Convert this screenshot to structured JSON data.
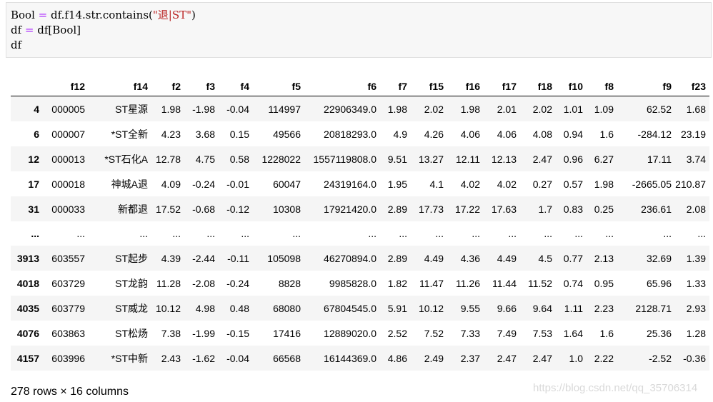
{
  "code_lines": [
    {
      "pre": "Bool ",
      "op": "=",
      "mid": " df.f14.str.contains(",
      "str": "\"退|ST\"",
      "post": ")"
    },
    {
      "pre": "df ",
      "op": "=",
      "mid": " df[Bool]",
      "str": "",
      "post": ""
    },
    {
      "pre": "df",
      "op": "",
      "mid": "",
      "str": "",
      "post": ""
    }
  ],
  "table": {
    "columns": [
      "",
      "f12",
      "f14",
      "f2",
      "f3",
      "f4",
      "f5",
      "f6",
      "f7",
      "f15",
      "f16",
      "f17",
      "f18",
      "f10",
      "f8",
      "f9",
      "f23"
    ],
    "rows": [
      [
        "4",
        "000005",
        "ST星源",
        "1.98",
        "-1.98",
        "-0.04",
        "114997",
        "22906349.0",
        "1.98",
        "2.02",
        "1.98",
        "2.01",
        "2.02",
        "1.01",
        "1.09",
        "62.52",
        "1.68"
      ],
      [
        "6",
        "000007",
        "*ST全新",
        "4.23",
        "3.68",
        "0.15",
        "49566",
        "20818293.0",
        "4.9",
        "4.26",
        "4.06",
        "4.06",
        "4.08",
        "0.94",
        "1.6",
        "-284.12",
        "23.19"
      ],
      [
        "12",
        "000013",
        "*ST石化A",
        "12.78",
        "4.75",
        "0.58",
        "1228022",
        "1557119808.0",
        "9.51",
        "13.27",
        "12.11",
        "12.13",
        "2.47",
        "0.96",
        "6.27",
        "17.11",
        "3.74"
      ],
      [
        "17",
        "000018",
        "神城A退",
        "4.09",
        "-0.24",
        "-0.01",
        "60047",
        "24319164.0",
        "1.95",
        "4.1",
        "4.02",
        "4.02",
        "0.27",
        "0.57",
        "1.98",
        "-2665.05",
        "210.87"
      ],
      [
        "31",
        "000033",
        "新都退",
        "17.52",
        "-0.68",
        "-0.12",
        "10308",
        "17921420.0",
        "2.89",
        "17.73",
        "17.22",
        "17.63",
        "1.7",
        "0.83",
        "0.25",
        "236.61",
        "2.08"
      ],
      [
        "...",
        "...",
        "...",
        "...",
        "...",
        "...",
        "...",
        "...",
        "...",
        "...",
        "...",
        "...",
        "...",
        "...",
        "...",
        "...",
        "..."
      ],
      [
        "3913",
        "603557",
        "ST起步",
        "4.39",
        "-2.44",
        "-0.11",
        "105098",
        "46270894.0",
        "2.89",
        "4.49",
        "4.36",
        "4.49",
        "4.5",
        "0.77",
        "2.13",
        "32.69",
        "1.39"
      ],
      [
        "4018",
        "603729",
        "ST龙韵",
        "11.28",
        "-2.08",
        "-0.24",
        "8828",
        "9985828.0",
        "1.82",
        "11.47",
        "11.26",
        "11.44",
        "11.52",
        "0.74",
        "0.95",
        "65.96",
        "1.33"
      ],
      [
        "4035",
        "603779",
        "ST威龙",
        "10.12",
        "4.98",
        "0.48",
        "68080",
        "67804545.0",
        "5.91",
        "10.12",
        "9.55",
        "9.66",
        "9.64",
        "1.11",
        "2.23",
        "2128.71",
        "2.93"
      ],
      [
        "4076",
        "603863",
        "ST松炀",
        "7.38",
        "-1.99",
        "-0.15",
        "17416",
        "12889020.0",
        "2.52",
        "7.52",
        "7.33",
        "7.49",
        "7.53",
        "1.64",
        "1.6",
        "25.36",
        "1.28"
      ],
      [
        "4157",
        "603996",
        "*ST中新",
        "2.43",
        "-1.62",
        "-0.04",
        "66568",
        "16144369.0",
        "4.86",
        "2.49",
        "2.37",
        "2.47",
        "2.47",
        "1.0",
        "2.22",
        "-2.52",
        "-0.36"
      ]
    ]
  },
  "footer": "278 rows × 16 columns",
  "watermark": "https://blog.csdn.net/qq_35706314"
}
